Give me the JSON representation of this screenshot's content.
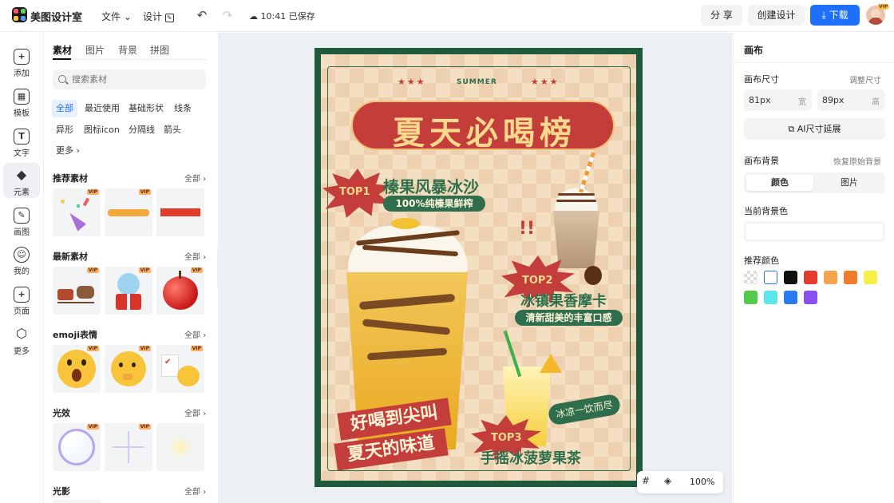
{
  "topbar": {
    "app_title": "美图设计室",
    "menu_file": "文件",
    "menu_design": "设计",
    "save_status": "10:41 已保存",
    "share_label": "分 享",
    "create_label": "创建设计",
    "download_label": "下载",
    "vip_badge": "VIP"
  },
  "leftnav": {
    "items": [
      {
        "label": "添加",
        "glyph": "+"
      },
      {
        "label": "模板",
        "glyph": "▦"
      },
      {
        "label": "文字",
        "glyph": "T"
      },
      {
        "label": "元素",
        "glyph": "◆"
      },
      {
        "label": "画图",
        "glyph": "✎"
      },
      {
        "label": "我的",
        "glyph": "☺"
      },
      {
        "label": "页面",
        "glyph": "+"
      },
      {
        "label": "更多",
        "glyph": "⬡"
      }
    ]
  },
  "panel": {
    "tabs": [
      "素材",
      "图片",
      "背景",
      "拼图"
    ],
    "search_placeholder": "搜索素材",
    "chips": [
      "全部",
      "最近使用",
      "基础形状",
      "线条",
      "异形",
      "图标icon",
      "分隔线",
      "箭头",
      "更多"
    ],
    "sections": [
      {
        "title": "推荐素材",
        "all": "全部"
      },
      {
        "title": "最新素材",
        "all": "全部"
      },
      {
        "title": "emoji表情",
        "all": "全部"
      },
      {
        "title": "光效",
        "all": "全部"
      },
      {
        "title": "光影",
        "all": "全部"
      }
    ],
    "vip": "VIP"
  },
  "poster": {
    "summer": "SUMMER",
    "stars": "★★★",
    "headline": "夏天必喝榜",
    "top1_badge": "TOP1",
    "top1_name": "榛果风暴冰沙",
    "top1_desc": "100%纯榛果鲜榨",
    "top2_badge": "TOP2",
    "top2_name": "冰镇果香摩卡",
    "top2_desc": "清新甜美的丰富口感",
    "top3_badge": "TOP3",
    "top3_name": "手摇冰菠萝果茶",
    "top3_bubble": "冰凉一饮而尽",
    "banner1": "好喝到尖叫",
    "banner2": "夏天的味道"
  },
  "zoom": {
    "value": "100%"
  },
  "rightpanel": {
    "title": "画布",
    "size_label": "画布尺寸",
    "adjust_size": "调整尺寸",
    "width_value": "81px",
    "width_unit": "宽",
    "height_value": "89px",
    "height_unit": "高",
    "ai_extend": "AI尺寸延展",
    "bg_label": "画布背景",
    "restore_bg": "恢复原始背景",
    "seg_color": "颜色",
    "seg_image": "图片",
    "current_bg": "当前背景色",
    "recommend": "推荐颜色",
    "colors": [
      "transparent",
      "#ffffff",
      "#111111",
      "#e53b2c",
      "#f2a54a",
      "#f07b2a",
      "#f5ef4a",
      "#55c94a",
      "#5ce8ea",
      "#2a7bef",
      "#8a4ff0"
    ]
  }
}
